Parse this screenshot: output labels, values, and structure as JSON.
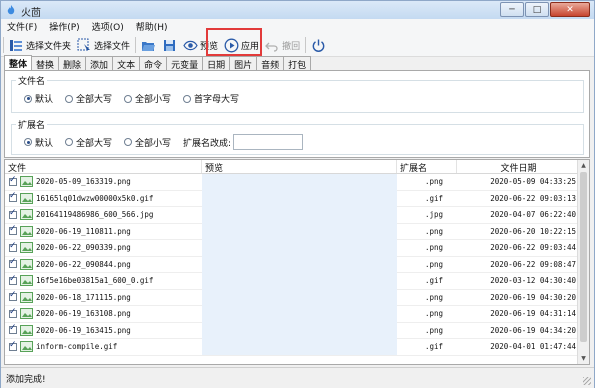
{
  "window": {
    "title": "火茴"
  },
  "menu": [
    "文件(F)",
    "操作(P)",
    "选项(O)",
    "帮助(H)"
  ],
  "toolbar": {
    "select_folder": "选择文件夹",
    "select_file": "选择文件",
    "preview": "预览",
    "apply": "应用",
    "undo": "撤回"
  },
  "tabs": [
    "整体",
    "替换",
    "删除",
    "添加",
    "文本",
    "命令",
    "元变量",
    "日期",
    "图片",
    "音频",
    "打包"
  ],
  "panel": {
    "filename_group": "文件名",
    "filename_options": [
      "默认",
      "全部大写",
      "全部小写",
      "首字母大写"
    ],
    "ext_group": "扩展名",
    "ext_options": [
      "默认",
      "全部大写",
      "全部小写"
    ],
    "ext_change_label": "扩展名改成:",
    "ext_change_value": ""
  },
  "table": {
    "headers": {
      "file": "文件",
      "preview": "预览",
      "ext": "扩展名",
      "date": "文件日期"
    },
    "rows": [
      {
        "name": "2020-05-09_163319.png",
        "ext": ".png",
        "date": "2020-05-09 04:33:25"
      },
      {
        "name": "16165lq01dwzw00000x5k0.gif",
        "ext": ".gif",
        "date": "2020-06-22 09:03:13"
      },
      {
        "name": "20164119486986_600_566.jpg",
        "ext": ".jpg",
        "date": "2020-04-07 06:22:40"
      },
      {
        "name": "2020-06-19_110811.png",
        "ext": ".png",
        "date": "2020-06-20 10:22:15"
      },
      {
        "name": "2020-06-22_090339.png",
        "ext": ".png",
        "date": "2020-06-22 09:03:44"
      },
      {
        "name": "2020-06-22_090844.png",
        "ext": ".png",
        "date": "2020-06-22 09:08:47"
      },
      {
        "name": "16f5e16be03815a1_600_0.gif",
        "ext": ".gif",
        "date": "2020-03-12 04:30:40"
      },
      {
        "name": "2020-06-18_171115.png",
        "ext": ".png",
        "date": "2020-06-19 04:30:20"
      },
      {
        "name": "2020-06-19_163108.png",
        "ext": ".png",
        "date": "2020-06-19 04:31:14"
      },
      {
        "name": "2020-06-19_163415.png",
        "ext": ".png",
        "date": "2020-06-19 04:34:20"
      },
      {
        "name": "inform-compile.gif",
        "ext": ".gif",
        "date": "2020-04-01 01:47:44"
      }
    ]
  },
  "status": {
    "text": "添加完成!"
  }
}
